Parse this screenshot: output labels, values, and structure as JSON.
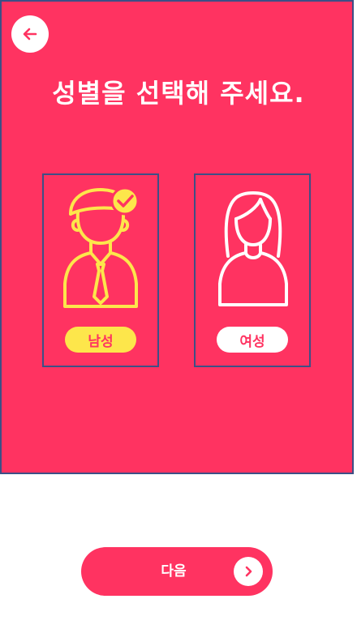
{
  "header": {
    "back_icon": "arrow-left-icon",
    "title": "성별을 선택해 주세요."
  },
  "options": [
    {
      "label": "남성",
      "icon": "male-person-icon",
      "selected": true
    },
    {
      "label": "여성",
      "icon": "female-person-icon",
      "selected": false
    }
  ],
  "footer": {
    "next_label": "다음",
    "next_icon": "chevron-right-icon"
  },
  "colors": {
    "primary": "#ff3361",
    "selected": "#fde64b",
    "white": "#ffffff",
    "outline": "#3d4f86"
  }
}
